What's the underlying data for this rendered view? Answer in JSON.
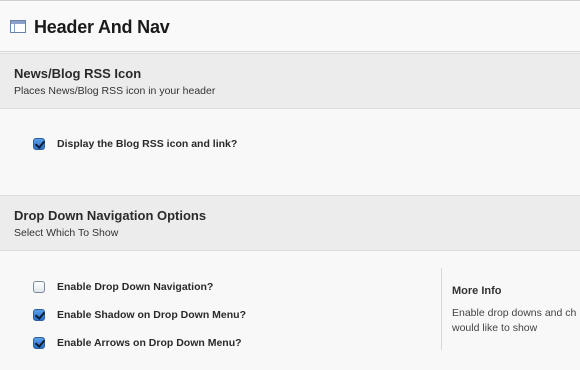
{
  "header": {
    "title": "Header And Nav",
    "icon": "window-icon"
  },
  "sections": {
    "rss": {
      "title": "News/Blog RSS Icon",
      "description": "Places News/Blog RSS icon in your header",
      "options": [
        {
          "label": "Display the Blog RSS icon and link?",
          "checked": true
        }
      ]
    },
    "nav": {
      "title": "Drop Down Navigation Options",
      "description": "Select Which To Show",
      "options": [
        {
          "label": "Enable Drop Down Navigation?",
          "checked": false
        },
        {
          "label": "Enable Shadow on Drop Down Menu?",
          "checked": true
        },
        {
          "label": "Enable Arrows on Drop Down Menu?",
          "checked": true
        }
      ],
      "more_info": {
        "title": "More Info",
        "text": "Enable drop downs and ch\nwould like to show"
      }
    }
  },
  "colors": {
    "checkbox_checked": "#2a6fc8",
    "section_background": "#ececec"
  }
}
